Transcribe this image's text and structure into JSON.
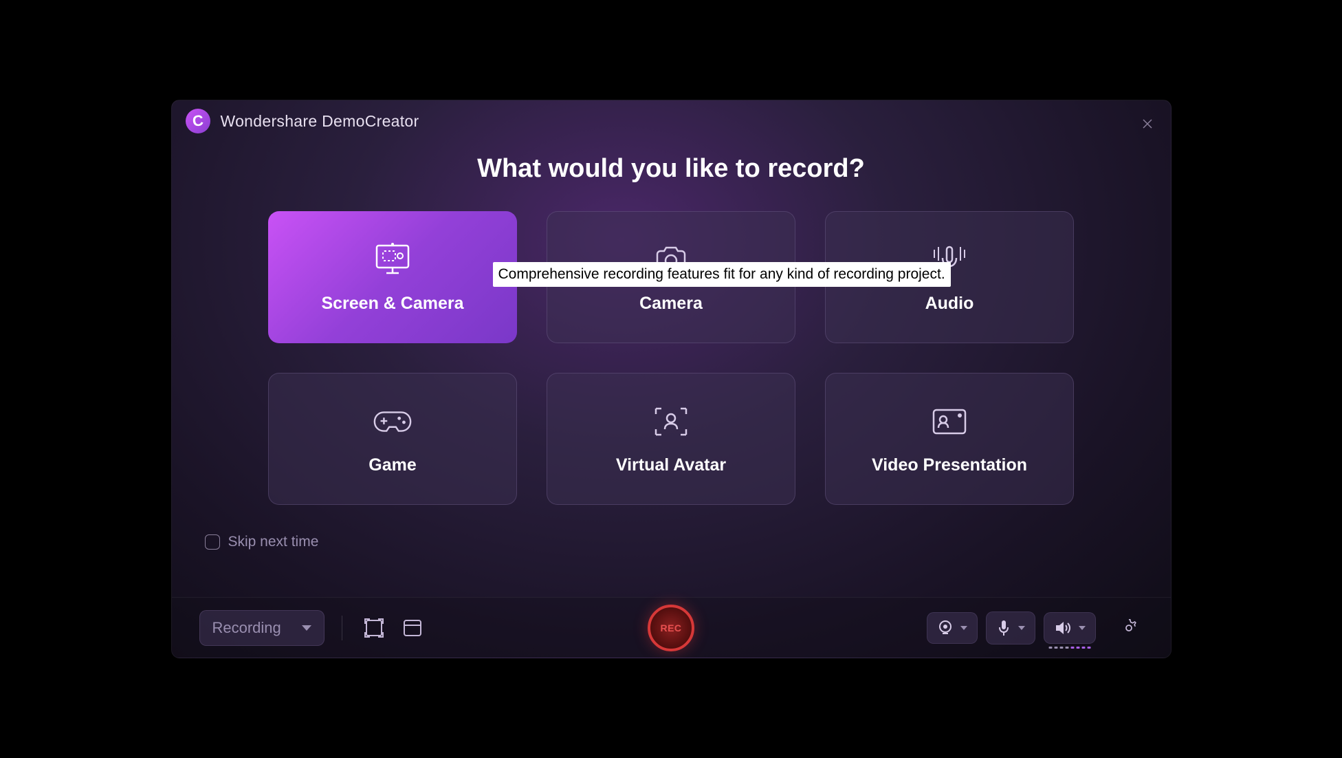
{
  "titlebar": {
    "app_title": "Wondershare DemoCreator"
  },
  "headline": "What would you like to record?",
  "cards": [
    {
      "label": "Screen & Camera",
      "icon": "screen-camera",
      "active": true
    },
    {
      "label": "Camera",
      "icon": "camera",
      "active": false
    },
    {
      "label": "Audio",
      "icon": "audio",
      "active": false
    },
    {
      "label": "Game",
      "icon": "game",
      "active": false
    },
    {
      "label": "Virtual Avatar",
      "icon": "virtual-avatar",
      "active": false
    },
    {
      "label": "Video Presentation",
      "icon": "video-presentation",
      "active": false
    }
  ],
  "tooltip": "Comprehensive recording features fit for any kind of recording project.",
  "skip": {
    "label": "Skip next time",
    "checked": false
  },
  "toolbar": {
    "mode_label": "Recording",
    "rec_label": "REC"
  }
}
